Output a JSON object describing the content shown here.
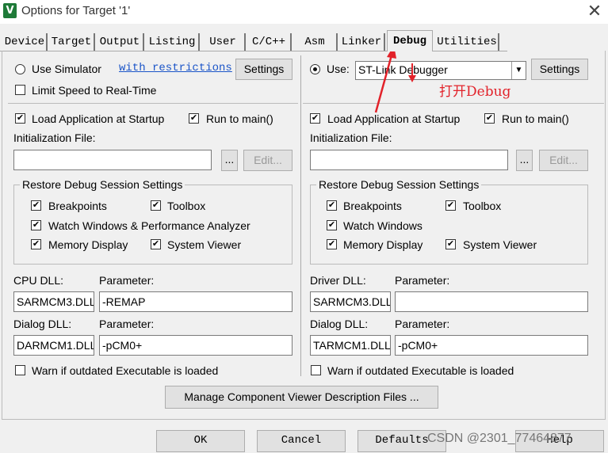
{
  "window": {
    "title": "Options for Target '1'",
    "icon_letter": "V",
    "close_glyph": "✕"
  },
  "tabs": [
    {
      "label": "Device"
    },
    {
      "label": "Target"
    },
    {
      "label": "Output"
    },
    {
      "label": "Listing"
    },
    {
      "label": "User"
    },
    {
      "label": "C/C++"
    },
    {
      "label": "Asm"
    },
    {
      "label": "Linker"
    },
    {
      "label": "Debug",
      "active": true
    },
    {
      "label": "Utilities"
    }
  ],
  "left": {
    "use_simulator": {
      "label": "Use Simulator",
      "selected": false
    },
    "restrictions_link": "with restrictions",
    "settings_label": "Settings",
    "limit_speed": {
      "label": "Limit Speed to Real-Time",
      "checked": false
    },
    "load_app": {
      "label": "Load Application at Startup",
      "checked": true
    },
    "run_to_main": {
      "label": "Run to main()",
      "checked": true
    },
    "init_file_label": "Initialization File:",
    "init_file_value": "",
    "browse_label": "...",
    "edit_label": "Edit...",
    "restore_title": "Restore Debug Session Settings",
    "breakpoints": {
      "label": "Breakpoints",
      "checked": true
    },
    "toolbox": {
      "label": "Toolbox",
      "checked": true
    },
    "watch_windows": {
      "label": "Watch Windows & Performance Analyzer",
      "checked": true
    },
    "memory_display": {
      "label": "Memory Display",
      "checked": true
    },
    "system_viewer": {
      "label": "System Viewer",
      "checked": true
    },
    "cpu_dll_label": "CPU DLL:",
    "cpu_param_label": "Parameter:",
    "cpu_dll_value": "SARMCM3.DLL",
    "cpu_param_value": "-REMAP",
    "dialog_dll_label": "Dialog DLL:",
    "dialog_param_label": "Parameter:",
    "dialog_dll_value": "DARMCM1.DLL",
    "dialog_param_value": "-pCM0+",
    "warn_outdated": {
      "label": "Warn if outdated Executable is loaded",
      "checked": false
    }
  },
  "right": {
    "use": {
      "label": "Use:",
      "selected": true
    },
    "debugger_value": "ST-Link Debugger",
    "settings_label": "Settings",
    "load_app": {
      "label": "Load Application at Startup",
      "checked": true
    },
    "run_to_main": {
      "label": "Run to main()",
      "checked": true
    },
    "init_file_label": "Initialization File:",
    "init_file_value": "",
    "browse_label": "...",
    "edit_label": "Edit...",
    "restore_title": "Restore Debug Session Settings",
    "breakpoints": {
      "label": "Breakpoints",
      "checked": true
    },
    "toolbox": {
      "label": "Toolbox",
      "checked": true
    },
    "watch_windows": {
      "label": "Watch Windows",
      "checked": true
    },
    "memory_display": {
      "label": "Memory Display",
      "checked": true
    },
    "system_viewer": {
      "label": "System Viewer",
      "checked": true
    },
    "driver_dll_label": "Driver DLL:",
    "driver_param_label": "Parameter:",
    "driver_dll_value": "SARMCM3.DLL",
    "driver_param_value": "",
    "dialog_dll_label": "Dialog DLL:",
    "dialog_param_label": "Parameter:",
    "dialog_dll_value": "TARMCM1.DLL",
    "dialog_param_value": "-pCM0+",
    "warn_outdated": {
      "label": "Warn if outdated Executable is loaded",
      "checked": false
    }
  },
  "manage_button": "Manage Component Viewer Description Files ...",
  "footer": {
    "ok": "OK",
    "cancel": "Cancel",
    "defaults": "Defaults",
    "help": "Help"
  },
  "annotation": {
    "text": "打开Debug",
    "color": "#e2222a"
  },
  "watermark": "CSDN @2301_77464877"
}
